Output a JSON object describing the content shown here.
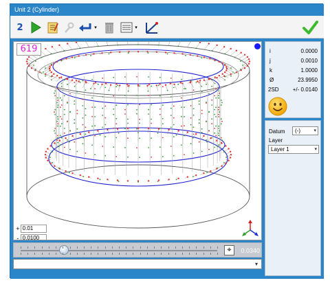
{
  "window": {
    "title": "Unit 2 (Cylinder)"
  },
  "toolbar": {
    "step_number": "2"
  },
  "viewport": {
    "point_count": "619",
    "tol_plus_sign": "+",
    "tol_plus": "0.01",
    "tol_minus_sign": "-",
    "tol_minus": "0.0100"
  },
  "slider": {
    "value": "0.0340",
    "position": 0.22
  },
  "results": {
    "i": {
      "key": "i",
      "value": "0.0000"
    },
    "j": {
      "key": "j",
      "value": "0.0010"
    },
    "k": {
      "key": "k",
      "value": "1.0000"
    },
    "diameter": {
      "key": "Ø",
      "value": "23.9950"
    },
    "two_sd": {
      "key": "2SD",
      "value": "+/- 0.0140"
    }
  },
  "datum": {
    "label": "Datum",
    "selected": "(-)"
  },
  "layer": {
    "label": "Layer",
    "selected": "Layer 1"
  },
  "colors": {
    "title_blue": "#2b86c9",
    "point_red": "#e03030",
    "point_green": "#2a9a2a",
    "circle_blue": "#2020d0",
    "ok_green": "#3dbb2e",
    "pink": "#e020d8"
  }
}
